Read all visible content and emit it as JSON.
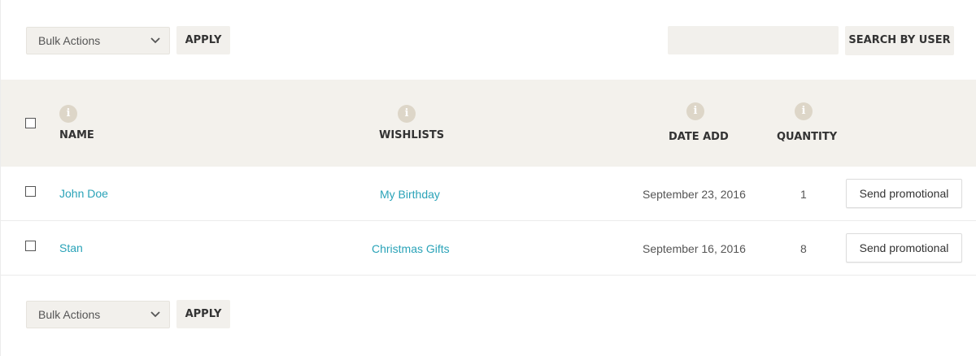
{
  "top_bar": {
    "bulk_actions_label": "Bulk Actions",
    "apply_label": "APPLY",
    "search_value": "",
    "search_button_label": "SEARCH BY USER"
  },
  "table": {
    "headers": {
      "name": "NAME",
      "wishlists": "WISHLISTS",
      "date_add": "DATE ADD",
      "quantity": "QUANTITY"
    },
    "info_icon_glyph": "i",
    "rows": [
      {
        "name": "John Doe",
        "wishlist": "My Birthday",
        "date": "September 23, 2016",
        "quantity": "1",
        "action": "Send promotional"
      },
      {
        "name": "Stan",
        "wishlist": "Christmas Gifts",
        "date": "September 16, 2016",
        "quantity": "8",
        "action": "Send promotional"
      }
    ]
  },
  "bottom_bar": {
    "bulk_actions_label": "Bulk Actions",
    "apply_label": "APPLY"
  },
  "colors": {
    "link": "#2aa3b8",
    "header_bg": "#f3f1ec",
    "control_bg": "#f2f0ec",
    "info_icon": "#ddd6c8"
  }
}
